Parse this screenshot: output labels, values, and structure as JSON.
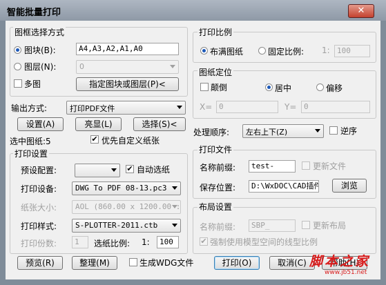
{
  "window": {
    "title": "智能批量打印",
    "close_glyph": "✕"
  },
  "frame_select": {
    "title": "图框选择方式",
    "block_radio": "图块(B):",
    "block_value": "A4,A3,A2,A1,A0",
    "layer_radio": "图层(N):",
    "layer_value": "0",
    "multi_check": "多图",
    "pick_button": "指定图块或图层(P)<"
  },
  "output": {
    "label": "输出方式:",
    "value": "打印PDF文件",
    "settings_button": "设置(A)",
    "highlight_button": "亮显(L)",
    "select_button": "选择(S)<",
    "selected_count": "选中图纸:5",
    "custom_paper_check": "优先自定义纸张"
  },
  "print_settings": {
    "title": "打印设置",
    "preset_label": "预设配置:",
    "preset_value": "",
    "auto_select_check": "自动选纸",
    "device_label": "打印设备:",
    "device_value": "DWG To PDF 08-13.pc3",
    "paper_label": "纸张大小:",
    "paper_value": "AOL (860.00 x 1200.00 :",
    "style_label": "打印样式:",
    "style_value": "S-PLOTTER-2011.ctb",
    "copies_label": "打印份数:",
    "copies_value": "1",
    "scale_label": "选纸比例:",
    "scale_sep": "1:",
    "scale_value": "100"
  },
  "print_scale": {
    "title": "打印比例",
    "fit_radio": "布满图纸",
    "fixed_radio": "固定比例:",
    "fixed_sep": "1:",
    "fixed_value": "100"
  },
  "position": {
    "title": "图纸定位",
    "invert_check": "颠倒",
    "center_radio": "居中",
    "offset_radio": "偏移",
    "x_label": "X=",
    "x_value": "0",
    "y_label": "Y=",
    "y_value": "0"
  },
  "order": {
    "label": "处理顺序:",
    "value": "左右上下(Z)",
    "reverse_check": "逆序"
  },
  "print_file": {
    "title": "打印文件",
    "prefix_label": "名称前缀:",
    "prefix_value": "test-",
    "update_file_check": "更新文件",
    "save_label": "保存位置:",
    "save_value": "D:\\WxDOC\\CAD插件\\",
    "browse_button": "浏览"
  },
  "layout": {
    "title": "布局设置",
    "prefix_label": "名称前缀:",
    "prefix_value": "SBP_",
    "update_layout_check": "更新布局",
    "force_linetype_check": "强制使用模型空间的线型比例"
  },
  "footer": {
    "preview_button": "预览(R)",
    "arrange_button": "整理(M)",
    "wdg_check": "生成WDG文件",
    "print_button": "打印(O)",
    "cancel_button": "取消(C)",
    "help_button": "帮助(H)"
  },
  "watermark": {
    "text": "脚本之家",
    "url": "www.jb51.net"
  }
}
